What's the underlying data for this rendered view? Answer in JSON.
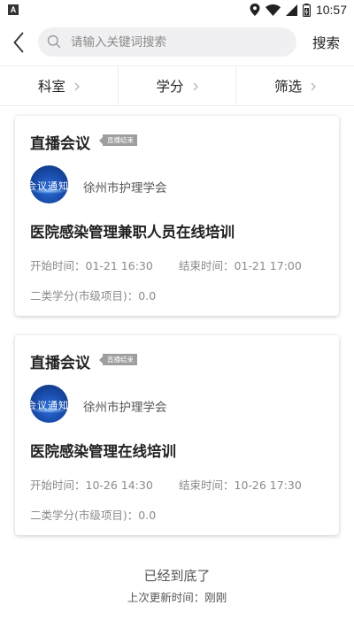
{
  "status_bar": {
    "time": "10:57",
    "icons": [
      "notification-a-icon",
      "location-icon",
      "wifi-icon",
      "signal-icon",
      "battery-icon"
    ]
  },
  "search": {
    "placeholder": "请输入关键词搜索",
    "value": "",
    "button_label": "搜索"
  },
  "filters": [
    {
      "label": "科室"
    },
    {
      "label": "学分"
    },
    {
      "label": "筛选"
    }
  ],
  "cards": [
    {
      "type": "直播会议",
      "status_tag": "直播结束",
      "org_avatar_text": "会议通知",
      "org_name": "徐州市护理学会",
      "title": "医院感染管理兼职人员在线培训",
      "start_label": "开始时间：",
      "start_time": "01-21 16:30",
      "end_label": "结束时间：",
      "end_time": "01-21 17:00",
      "credit_label": "二类学分(市级项目)：",
      "credit_value": "0.0"
    },
    {
      "type": "直播会议",
      "status_tag": "直播结束",
      "org_avatar_text": "会议通知",
      "org_name": "徐州市护理学会",
      "title": "医院感染管理在线培训",
      "start_label": "开始时间：",
      "start_time": "10-26 14:30",
      "end_label": "结束时间：",
      "end_time": "10-26 17:30",
      "credit_label": "二类学分(市级项目)：",
      "credit_value": "0.0"
    }
  ],
  "footer": {
    "end_text": "已经到底了",
    "updated_label": "上次更新时间：",
    "updated_value": "刚刚"
  },
  "colors": {
    "tag_bg": "#9e9e9e",
    "search_bg": "#f0f0f2",
    "avatar_blue": "#1a4fb0"
  }
}
